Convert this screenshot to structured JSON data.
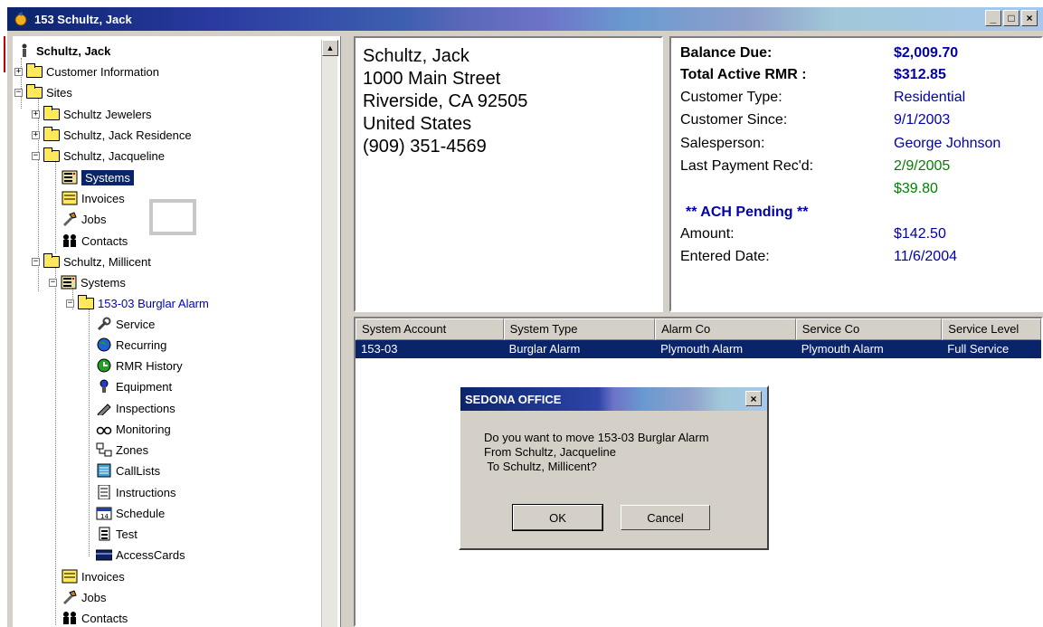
{
  "window": {
    "title": "153  Schultz, Jack",
    "min_label": "_",
    "max_label": "□",
    "close_label": "×"
  },
  "tree": {
    "root": "Schultz, Jack",
    "customer_info": "Customer Information",
    "sites": "Sites",
    "site1": "Schultz Jewelers",
    "site2": "Schultz, Jack Residence",
    "site3": "Schultz, Jacqueline",
    "site3_systems": "Systems",
    "site3_invoices": "Invoices",
    "site3_jobs": "Jobs",
    "site3_contacts": "Contacts",
    "site4": "Schultz, Millicent",
    "site4_systems": "Systems",
    "system": "153-03  Burglar Alarm",
    "service": "Service",
    "recurring": "Recurring",
    "rmr_history": "RMR History",
    "equipment": "Equipment",
    "inspections": "Inspections",
    "monitoring": "Monitoring",
    "zones": "Zones",
    "calllists": "CallLists",
    "instructions": "Instructions",
    "schedule": "Schedule",
    "test": "Test",
    "accesscards": "AccessCards",
    "site4_invoices": "Invoices",
    "site4_jobs": "Jobs",
    "site4_contacts": "Contacts"
  },
  "address": {
    "name": "Schultz, Jack",
    "street": "1000 Main Street",
    "city": "Riverside, CA  92505",
    "country": "United States",
    "phone": "(909) 351-4569"
  },
  "balance": {
    "balance_due_label": "Balance Due:",
    "balance_due": "$2,009.70",
    "rmr_label": "Total Active RMR :",
    "rmr": "$312.85",
    "cust_type_label": "Customer Type:",
    "cust_type": "Residential",
    "since_label": "Customer Since:",
    "since": "9/1/2003",
    "sales_label": "Salesperson:",
    "sales": "George Johnson",
    "lastpay_label": "Last Payment Rec'd:",
    "lastpay_date": "2/9/2005",
    "lastpay_amount": "$39.80",
    "ach": "** ACH Pending **",
    "amount_label": "Amount:",
    "amount": "$142.50",
    "entered_label": "Entered Date:",
    "entered": "11/6/2004"
  },
  "grid": {
    "headers": [
      "System Account",
      "System Type",
      "Alarm Co",
      "Service Co",
      "Service Level"
    ],
    "row": [
      "153-03",
      "Burglar Alarm",
      "Plymouth Alarm",
      "Plymouth Alarm",
      "Full Service"
    ]
  },
  "dialog": {
    "title": "SEDONA OFFICE",
    "close": "×",
    "line1": "Do you want to move 153-03 Burglar Alarm",
    "line2": "From Schultz, Jacqueline",
    "line3": " To Schultz, Millicent?",
    "ok": "OK",
    "cancel": "Cancel"
  },
  "colors": {
    "selection": "#0a246a",
    "accent_blue": "#0000aa",
    "green": "#008000"
  }
}
